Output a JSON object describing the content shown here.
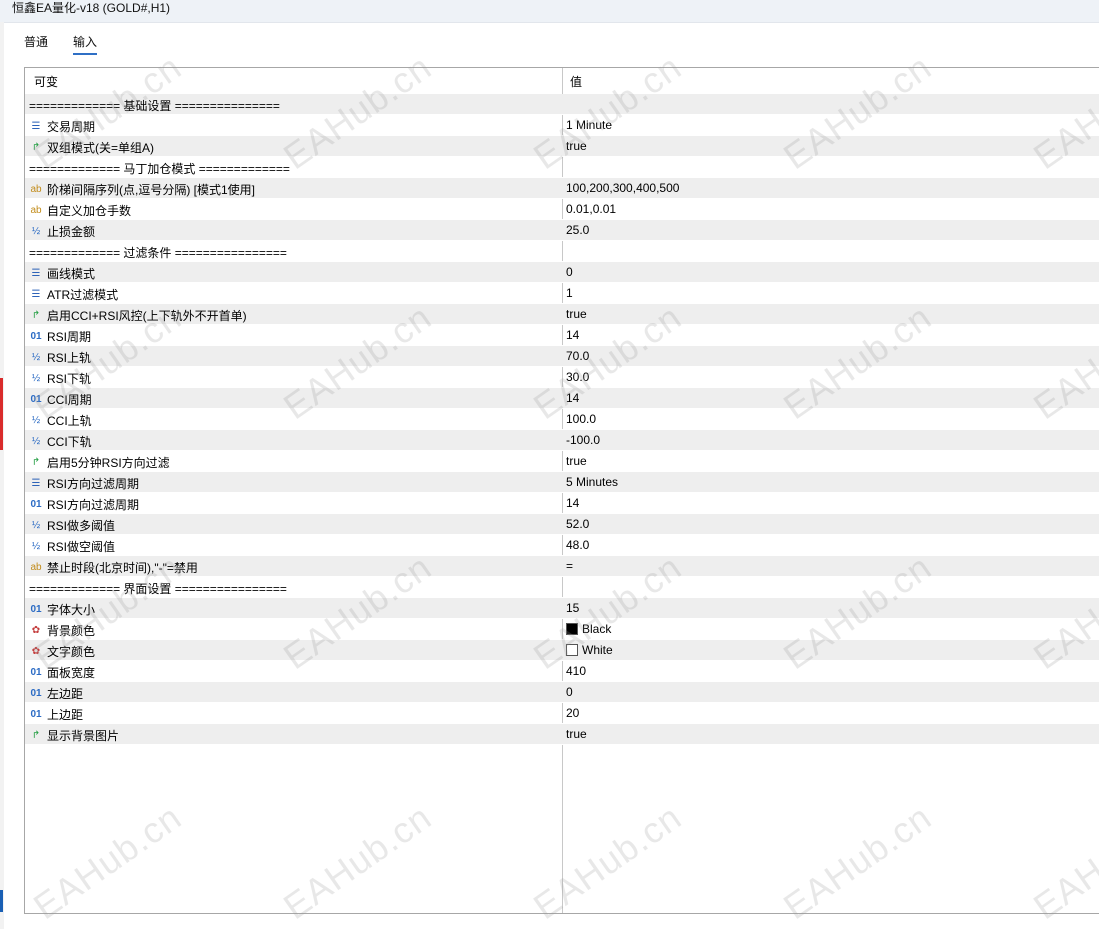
{
  "window": {
    "title": "恒鑫EA量化-v18 (GOLD#,H1)"
  },
  "tabs": [
    {
      "label": "普通",
      "active": false
    },
    {
      "label": "输入",
      "active": true
    }
  ],
  "grid": {
    "header": {
      "variable": "可变",
      "value": "值"
    },
    "rows": [
      {
        "name": "============= 基础设置 ===============",
        "value": "",
        "icon": "none",
        "section": true
      },
      {
        "name": "交易周期",
        "value": "1 Minute",
        "icon": "enum-icon"
      },
      {
        "name": "双组模式(关=单组A)",
        "value": "true",
        "icon": "bool-icon"
      },
      {
        "name": "============= 马丁加仓模式 =============",
        "value": "",
        "icon": "none",
        "section": true
      },
      {
        "name": "阶梯间隔序列(点,逗号分隔) [模式1使用]",
        "value": "100,200,300,400,500",
        "icon": "string-icon"
      },
      {
        "name": "自定义加仓手数",
        "value": "0.01,0.01",
        "icon": "string-icon"
      },
      {
        "name": "止损金额",
        "value": "25.0",
        "icon": "double-icon"
      },
      {
        "name": "============= 过滤条件 ================",
        "value": "",
        "icon": "none",
        "section": true
      },
      {
        "name": "画线模式",
        "value": "0",
        "icon": "enum-icon"
      },
      {
        "name": "ATR过滤模式",
        "value": "1",
        "icon": "enum-icon"
      },
      {
        "name": "启用CCI+RSI风控(上下轨外不开首单)",
        "value": "true",
        "icon": "bool-icon"
      },
      {
        "name": "RSI周期",
        "value": "14",
        "icon": "int-icon"
      },
      {
        "name": "RSI上轨",
        "value": "70.0",
        "icon": "double-icon"
      },
      {
        "name": "RSI下轨",
        "value": "30.0",
        "icon": "double-icon"
      },
      {
        "name": "CCI周期",
        "value": "14",
        "icon": "int-icon"
      },
      {
        "name": "CCI上轨",
        "value": "100.0",
        "icon": "double-icon"
      },
      {
        "name": "CCI下轨",
        "value": "-100.0",
        "icon": "double-icon"
      },
      {
        "name": "启用5分钟RSI方向过滤",
        "value": "true",
        "icon": "bool-icon"
      },
      {
        "name": "RSI方向过滤周期",
        "value": "5 Minutes",
        "icon": "enum-icon"
      },
      {
        "name": "RSI方向过滤周期",
        "value": "14",
        "icon": "int-icon"
      },
      {
        "name": "RSI做多阈值",
        "value": "52.0",
        "icon": "double-icon"
      },
      {
        "name": "RSI做空阈值",
        "value": "48.0",
        "icon": "double-icon"
      },
      {
        "name": "禁止时段(北京时间),\"-\"=禁用",
        "value": "=",
        "icon": "string-icon"
      },
      {
        "name": "============= 界面设置 ================",
        "value": "",
        "icon": "none",
        "section": true
      },
      {
        "name": "字体大小",
        "value": "15",
        "icon": "int-icon"
      },
      {
        "name": "背景颜色",
        "value": "Black",
        "icon": "color-icon",
        "swatch": "#000000"
      },
      {
        "name": "文字颜色",
        "value": "White",
        "icon": "color-icon",
        "swatch": "#ffffff"
      },
      {
        "name": "面板宽度",
        "value": "410",
        "icon": "int-icon"
      },
      {
        "name": "左边距",
        "value": "0",
        "icon": "int-icon"
      },
      {
        "name": "上边距",
        "value": "20",
        "icon": "int-icon"
      },
      {
        "name": "显示背景图片",
        "value": "true",
        "icon": "bool-icon"
      }
    ]
  },
  "watermark": {
    "text": "EAHub.cn"
  },
  "colors": {
    "tab_underline": "#2f6fc5",
    "row_alt": "#eeeeee",
    "grid_border": "#a7a7a7"
  }
}
